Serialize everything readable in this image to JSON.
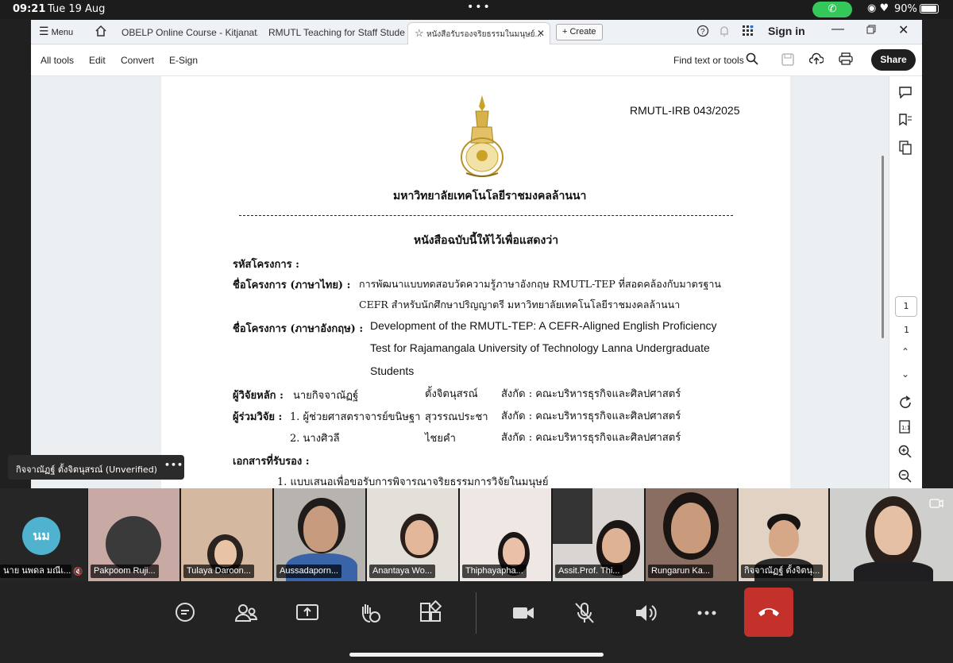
{
  "status_bar": {
    "time": "09:21",
    "date": "Tue 19 Aug",
    "battery": "90%"
  },
  "tabs": {
    "menu_label": "Menu",
    "items": [
      {
        "label": "OBELP Online Course - Kitjanat..."
      },
      {
        "label": "RMUTL Teaching for Staff Stude..."
      },
      {
        "label": "หนังสือรับรองจริยธรรมในมนุษย์..."
      }
    ],
    "create_label": "Create",
    "signin_label": "Sign in"
  },
  "toolbar": {
    "all_tools": "All tools",
    "edit": "Edit",
    "convert": "Convert",
    "esign": "E-Sign",
    "find": "Find text or tools",
    "share": "Share"
  },
  "document": {
    "ref": "RMUTL-IRB 043/2025",
    "university": "มหาวิทยาลัยเทคโนโลยีราชมงคลล้านนา",
    "heading": "หนังสือฉบับนี้ให้ไว้เพื่อแสดงว่า",
    "project_code_label": "รหัสโครงการ :",
    "name_th_label": "ชื่อโครงการ (ภาษาไทย) :",
    "name_th_line1": "การพัฒนาแบบทดสอบวัดความรู้ภาษาอังกฤษ RMUTL-TEP ที่สอดคล้องกับมาตรฐาน",
    "name_th_line2": "CEFR สำหรับนักศึกษาปริญญาตรี มหาวิทยาลัยเทคโนโลยีราชมงคลล้านนา",
    "name_en_label": "ชื่อโครงการ (ภาษาอังกฤษ) :",
    "name_en_line1": "Development of the RMUTL-TEP: A CEFR-Aligned English Proficiency",
    "name_en_line2": "Test for Rajamangala University of Technology Lanna Undergraduate",
    "name_en_line3": "Students",
    "pi_label": "ผู้วิจัยหลัก :",
    "pi_first": "นายกิจจาณัฏฐ์",
    "pi_last": "ตั้งจิตนุสรณ์",
    "pi_affil": "สังกัด : คณะบริหารธุรกิจและศิลปศาสตร์",
    "co_label": "ผู้ร่วมวิจัย :",
    "co1_first": "1. ผู้ช่วยศาสตราจารย์ขนิษฐา",
    "co1_last": "สุวรรณประชา",
    "co1_affil": "สังกัด : คณะบริหารธุรกิจและศิลปศาสตร์",
    "co2_first": "2. นางศิวลี",
    "co2_last": "ไชยคำ",
    "co2_affil": "สังกัด : คณะบริหารธุรกิจและศิลปศาสตร์",
    "docs_label": "เอกสารที่รับรอง :",
    "doc1": "1.   แบบเสนอเพื่อขอรับการพิจารณาจริยธรรมการวิจัยในมนุษย์"
  },
  "page_nav": {
    "current": "1",
    "total": "1"
  },
  "presenter_banner": "กิจจาณัฏฐ์ ตั้งจิตนุสรณ์ (Unverified)",
  "participants": [
    {
      "name": "นาย นพดล มณีเ...",
      "initials": "นม"
    },
    {
      "name": "Pakpoom Ruji..."
    },
    {
      "name": "Tulaya Daroon..."
    },
    {
      "name": "Aussadaporn..."
    },
    {
      "name": "Anantaya Wo..."
    },
    {
      "name": "Thiphayapha..."
    },
    {
      "name": "Assit.Prof. Thi..."
    },
    {
      "name": "Rungarun  Ka..."
    },
    {
      "name": "กิจจาณัฏฐ์  ตั้งจิตนุ..."
    },
    {
      "name": ""
    }
  ],
  "colors": {
    "leave": "#c4312b",
    "call_pill": "#34c759",
    "avatar": "#4fb3cf"
  }
}
